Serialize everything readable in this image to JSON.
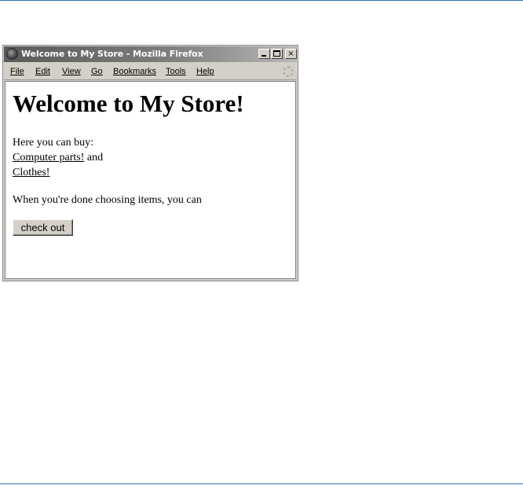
{
  "window": {
    "title": "Welcome to My Store - Mozilla Firefox",
    "controls": {
      "minimize": "minimize",
      "maximize": "maximize",
      "close": "×"
    }
  },
  "menu": {
    "items": [
      "File",
      "Edit",
      "View",
      "Go",
      "Bookmarks",
      "Tools",
      "Help"
    ]
  },
  "page": {
    "heading": "Welcome to My Store!",
    "intro": "Here you can buy:",
    "link_computer_parts": "Computer parts!",
    "and_text": " and",
    "link_clothes": "Clothes!",
    "done_text": "When you're done choosing items, you can",
    "checkout_button": "check out"
  }
}
